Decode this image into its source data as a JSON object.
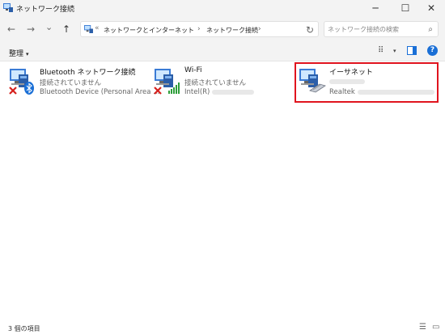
{
  "window": {
    "title": "ネットワーク接続",
    "minimize_glyph": "─",
    "maximize_glyph": "☐",
    "close_glyph": "✕"
  },
  "nav": {
    "back_glyph": "←",
    "forward_glyph": "→",
    "recent_glyph": "⌄",
    "up_glyph": "↑",
    "address": {
      "ellipsis": "«",
      "breadcrumbs": [
        "ネットワークとインターネット",
        "ネットワーク接続"
      ],
      "separator": "›"
    },
    "refresh_glyph": "↻",
    "search": {
      "placeholder": "ネットワーク接続の検索",
      "icon": "search-icon"
    }
  },
  "toolbar": {
    "organize_label": "整理",
    "organize_caret": "▾",
    "view_glyph": "⠿",
    "view_caret": "▾",
    "help_label": "?"
  },
  "connections": [
    {
      "name": "Bluetooth ネットワーク接続",
      "status": "接続されていません",
      "device": "Bluetooth Device (Personal Area ...",
      "icon": "network-adapter-icon",
      "overlay": "bluetooth-icon",
      "disconnected": true
    },
    {
      "name": "Wi-Fi",
      "status": "接続されていません",
      "device": "Intel(R)",
      "icon": "network-adapter-icon",
      "overlay": "signal-bars-icon",
      "disconnected": true
    },
    {
      "name": "イーサネット",
      "status": "",
      "device": "Realtek",
      "icon": "network-adapter-icon",
      "overlay": "ethernet-cable-icon",
      "disconnected": false,
      "highlighted": true
    }
  ],
  "statusbar": {
    "item_count": "3 個の項目",
    "details_glyph": "☰",
    "tiles_glyph": "▭"
  },
  "colors": {
    "accent": "#1a6fd6",
    "highlight_border": "#e0141e",
    "disconnected_x": "#d6201c",
    "signal_green": "#2e9e3a",
    "chrome_bg": "#f3f3f3"
  }
}
